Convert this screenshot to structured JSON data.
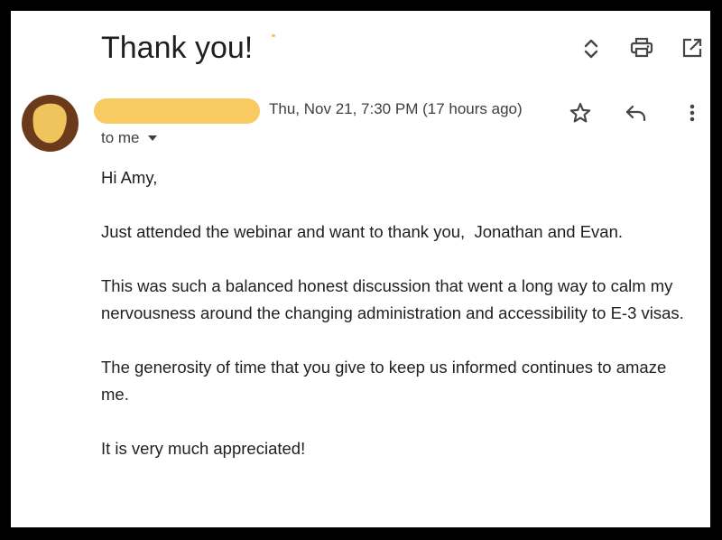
{
  "email": {
    "subject": "Thank you!",
    "date": "Thu, Nov 21, 7:30 PM (17 hours ago)",
    "recipient": "to me",
    "body": {
      "greeting": "Hi Amy,",
      "paragraph1": "Just attended the webinar and want to thank you,  Jonathan and Evan.",
      "paragraph2": "This was such a balanced honest discussion that went a long way to calm my nervousness around the changing administration and accessibility to E-3 visas.",
      "paragraph3": "The generosity of time that you give to keep us informed continues to amaze me.",
      "paragraph4": "It is very much appreciated!"
    }
  },
  "icons": {
    "expand": "unfold-icon",
    "print": "print-icon",
    "open_new_window": "open-in-new-icon",
    "star": "star-icon",
    "reply": "reply-icon",
    "more": "more-vert-icon",
    "dropdown": "chevron-down-icon"
  },
  "colors": {
    "redaction": "#f7cb62",
    "avatar_bg": "#6a3a1b",
    "avatar_fg": "#f0c45c",
    "text": "#1f1f1f",
    "secondary_text": "#3c4043",
    "frame": "#000000"
  }
}
